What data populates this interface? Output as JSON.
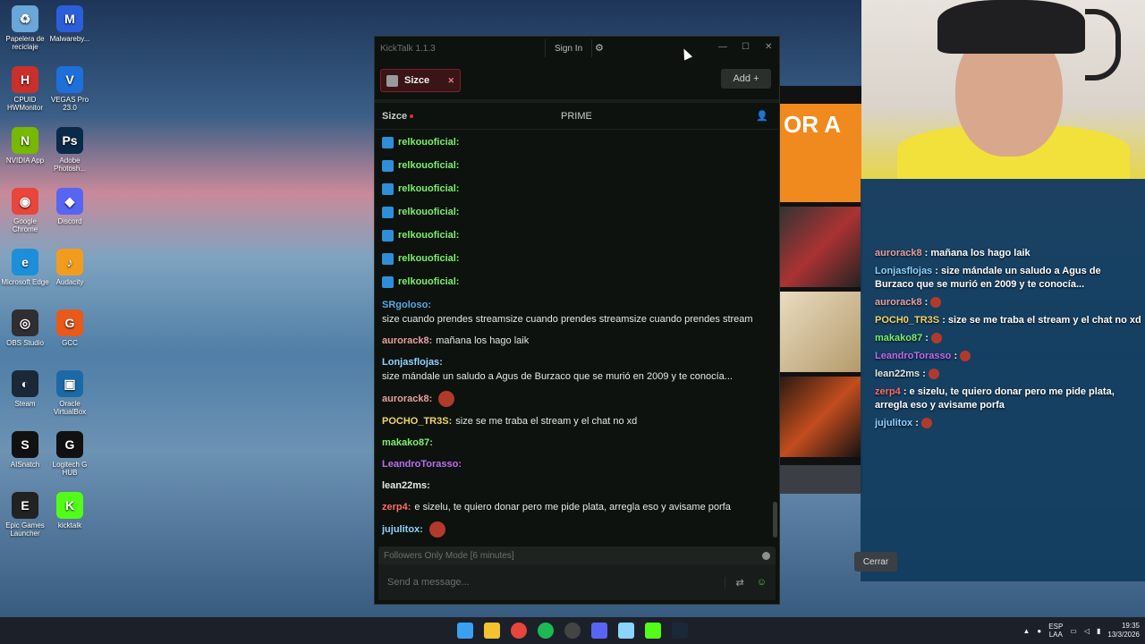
{
  "desktop": {
    "icons": [
      {
        "label": "Papelera de reciclaje",
        "color": "#6aa6d8",
        "glyph": "♻"
      },
      {
        "label": "Malwareby...",
        "color": "#2b5fd9",
        "glyph": "M"
      },
      {
        "label": "CPUID HWMonitor",
        "color": "#c9302c",
        "glyph": "H"
      },
      {
        "label": "VEGAS Pro 23.0",
        "color": "#1e6fd9",
        "glyph": "V"
      },
      {
        "label": "NVIDIA App",
        "color": "#76b900",
        "glyph": "N"
      },
      {
        "label": "Adobe Photosh...",
        "color": "#0b2a4a",
        "glyph": "Ps"
      },
      {
        "label": "Google Chrome",
        "color": "#e8453c",
        "glyph": "◉"
      },
      {
        "label": "Discord",
        "color": "#5865f2",
        "glyph": "◆"
      },
      {
        "label": "Microsoft Edge",
        "color": "#1d8fd8",
        "glyph": "e"
      },
      {
        "label": "Audacity",
        "color": "#f29c1f",
        "glyph": "♪"
      },
      {
        "label": "OBS Studio",
        "color": "#302e31",
        "glyph": "◎"
      },
      {
        "label": "GCC",
        "color": "#e8591a",
        "glyph": "G"
      },
      {
        "label": "Steam",
        "color": "#1b2838",
        "glyph": "◐"
      },
      {
        "label": "Oracle VirtualBox",
        "color": "#1b6aa6",
        "glyph": "▣"
      },
      {
        "label": "AISnatch",
        "color": "#111111",
        "glyph": "S"
      },
      {
        "label": "Logitech G HUB",
        "color": "#111111",
        "glyph": "G"
      },
      {
        "label": "Epic Games Launcher",
        "color": "#222222",
        "glyph": "E"
      },
      {
        "label": "kicktalk",
        "color": "#53fc18",
        "glyph": "K"
      }
    ]
  },
  "kicktalk": {
    "title": "KickTalk 1.1.3",
    "signin": "Sign In",
    "tab_label": "Sizce",
    "add_label": "Add",
    "channel": "Sizce",
    "prime": "PRIME",
    "mode": "Followers Only Mode [6 minutes]",
    "input_placeholder": "Send a message...",
    "messages": [
      {
        "user": "relkouoficial:",
        "text": "",
        "color": "#7cf06a",
        "badge": true
      },
      {
        "user": "relkouoficial:",
        "text": "",
        "color": "#7cf06a",
        "badge": true
      },
      {
        "user": "relkouoficial:",
        "text": "",
        "color": "#7cf06a",
        "badge": true
      },
      {
        "user": "relkouoficial:",
        "text": "",
        "color": "#7cf06a",
        "badge": true
      },
      {
        "user": "relkouoficial:",
        "text": "",
        "color": "#7cf06a",
        "badge": true
      },
      {
        "user": "relkouoficial:",
        "text": "",
        "color": "#7cf06a",
        "badge": true
      },
      {
        "user": "relkouoficial:",
        "text": "",
        "color": "#7cf06a",
        "badge": true
      },
      {
        "user": "SRgoloso:",
        "text": "size cuando prendes streamsize cuando prendes streamsize cuando prendes stream",
        "color": "#5aa9e6",
        "badge": false
      },
      {
        "user": "aurorack8:",
        "text": "mañana los hago laik",
        "color": "#e6a0a0",
        "badge": false
      },
      {
        "user": "Lonjasflojas:",
        "text": "size mándale un saludo a Agus de Burzaco que se murió en 2009 y te conocía...",
        "color": "#8fd3ff",
        "badge": false
      },
      {
        "user": "aurorack8:",
        "text": "",
        "color": "#e6a0a0",
        "badge": false,
        "emote": true
      },
      {
        "user": "POCHO_TR3S:",
        "text": "size se me traba el stream y el chat no xd",
        "color": "#f2d36b",
        "badge": false
      },
      {
        "user": "makako87:",
        "text": "",
        "color": "#7cf06a",
        "badge": false
      },
      {
        "user": "LeandroTorasso:",
        "text": "",
        "color": "#c06cf2",
        "badge": false
      },
      {
        "user": "lean22ms:",
        "text": "",
        "color": "#e5e8e6",
        "badge": false
      },
      {
        "user": "zerp4:",
        "text": "e sizelu, te quiero donar pero me pide plata, arregla eso y avisame porfa",
        "color": "#ff6a6a",
        "badge": false
      },
      {
        "user": "jujulitox:",
        "text": "",
        "color": "#8fd3ff",
        "badge": false,
        "emote": true
      }
    ]
  },
  "overlay_chat": [
    {
      "user": "aurorack8",
      "text": ": mañana los hago laik",
      "color": "#e6a0a0"
    },
    {
      "user": "Lonjasflojas",
      "text": ": size mándale un saludo a Agus de Burzaco que se murió en 2009 y te conocía...",
      "color": "#8fd3ff"
    },
    {
      "user": "aurorack8",
      "text": ":",
      "color": "#e6a0a0",
      "emote": true
    },
    {
      "user": "POCH0_TR3S",
      "text": ": size se me traba el stream y el chat no xd",
      "color": "#f2d36b"
    },
    {
      "user": "makako87",
      "text": ":",
      "color": "#7cf06a",
      "emote": true
    },
    {
      "user": "LeandroTorasso",
      "text": ":",
      "color": "#c06cf2",
      "emote": true
    },
    {
      "user": "lean22ms",
      "text": ":",
      "color": "#e5e8e6",
      "emote": true
    },
    {
      "user": "zerp4",
      "text": ": e sizelu, te quiero donar pero me pide plata, arregla eso y avisame porfa",
      "color": "#ff6a6a"
    },
    {
      "user": "jujulitox",
      "text": ":",
      "color": "#8fd3ff",
      "emote": true
    }
  ],
  "bg": {
    "promo_text": "OR A",
    "cerrar": "Cerrar"
  },
  "taskbar": {
    "lang1": "ESP",
    "lang2": "LAA",
    "time": "19:35",
    "date": "13/3/2026"
  }
}
